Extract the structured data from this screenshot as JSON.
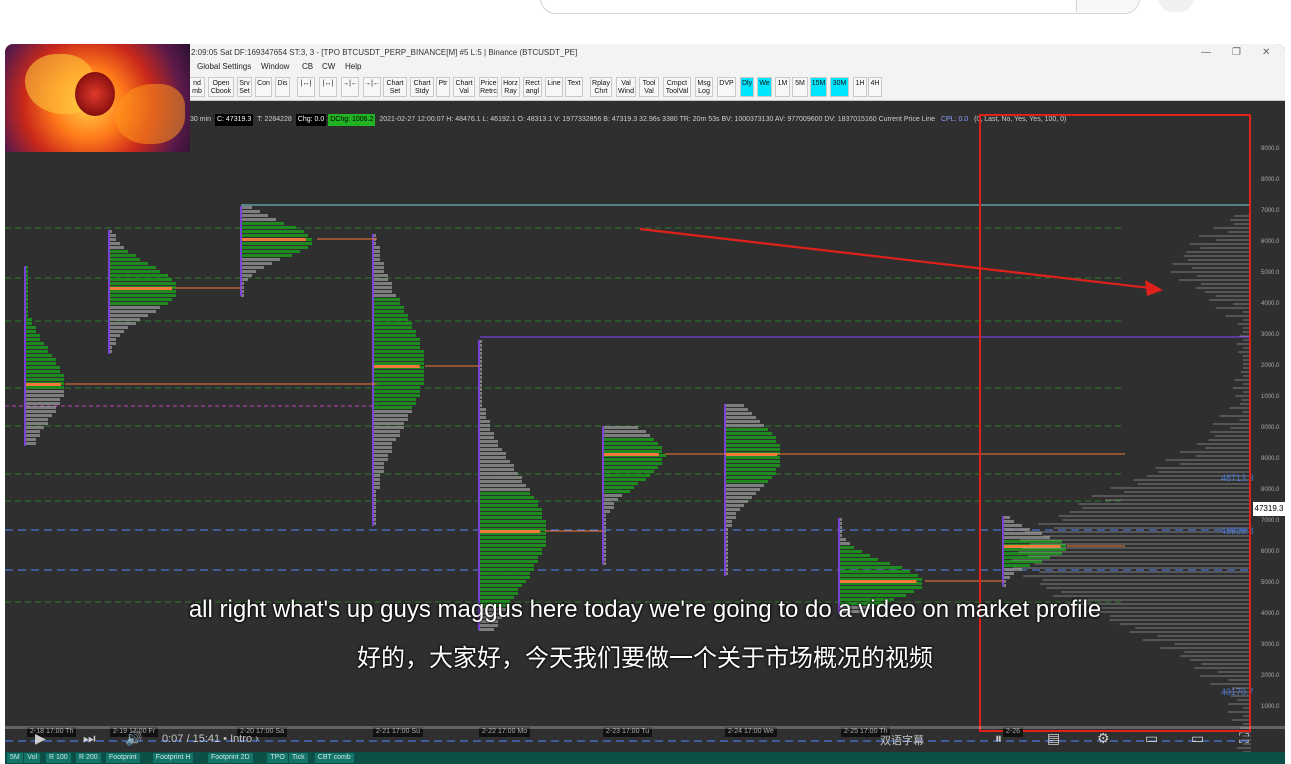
{
  "window": {
    "title": "2:09:05 Sat  DF:169347654  ST:3, 3 - [TPO BTCUSDT_PERP_BINANCE[M]  #5 L:5 | Binance (BTCUSDT_PE]"
  },
  "menu": [
    "Global Settings",
    "Window",
    "CB",
    "CW",
    "Help"
  ],
  "toolbar": {
    "buttons": [
      {
        "label": "nd\nmb"
      },
      {
        "label": "Open\nCbook"
      },
      {
        "label": "Srv\nSet"
      },
      {
        "label": "Con"
      },
      {
        "label": "Dis"
      },
      {
        "label": "|↔|"
      },
      {
        "label": "|↔|"
      },
      {
        "label": "→|←"
      },
      {
        "label": "→|←"
      },
      {
        "label": "Chart\nSet"
      },
      {
        "label": "Chart\nStdy"
      },
      {
        "label": "Ptr"
      },
      {
        "label": "Chart\nVal"
      },
      {
        "label": "Price\nRetrc"
      },
      {
        "label": "Horz\nRay"
      },
      {
        "label": "Rect\nangl"
      },
      {
        "label": "Line"
      },
      {
        "label": "Text"
      },
      {
        "label": "Rplay\nChrt"
      },
      {
        "label": "Val\nWind"
      },
      {
        "label": "Tool\nVal"
      },
      {
        "label": "Cmpct\nToolVal"
      },
      {
        "label": "Msg\nLog"
      },
      {
        "label": "DVP"
      },
      {
        "label": "Dly"
      },
      {
        "label": "We"
      },
      {
        "label": "1M"
      },
      {
        "label": "5M"
      },
      {
        "label": "15M"
      },
      {
        "label": "30M"
      },
      {
        "label": "1H"
      },
      {
        "label": "4H"
      }
    ]
  },
  "infobar": {
    "prefix": "30 min",
    "c_value": "C: 47319.3",
    "t_value": "T: 2284228",
    "chg": "Chg: 0.0",
    "dchg": "DChg: 1006.2",
    "details": "2021-02-27 12:00:07  H: 48476.1  L: 46192.1  O: 48313.1  V: 1977332856  B: 47319.3  32.96s 3380  TR: 20m 53s  BV: 1000373130  AV: 977009600  DV: 1837015160  Current Price Line",
    "cpl": "CPL: 0.0",
    "cpl_rest": "(0, Last, No, Yes, Yes, 100, 0)"
  },
  "price_tag": "47319.3",
  "level_labels": [
    {
      "text": "48713.9"
    },
    {
      "text": "46988.8"
    },
    {
      "text": "43170.7"
    }
  ],
  "price_axis": [
    "9000.0",
    "8000.0",
    "7000.0",
    "6000.0",
    "5000.0",
    "4000.0",
    "3000.0",
    "2000.0",
    "1000.0",
    "0000.0",
    "9000.0",
    "8000.0",
    "7000.0",
    "6000.0",
    "5000.0",
    "4000.0",
    "3000.0",
    "2000.0",
    "1000.0"
  ],
  "dates": [
    "2-18 17:00 Th",
    "2-19 17:00 Fr",
    "2-20 17:00 Sa",
    "2-21 17:00 Su",
    "2-22 17:00 Mo",
    "2-23 17:00 Tu",
    "2-24 17:00 We",
    "2-25 17:00 Th",
    "2-26"
  ],
  "subtitles": {
    "english": "all right what's up guys maggus here today we're going to do a video on market profile",
    "chinese": "好的，大家好，今天我们要做一个关于市场概况的视频"
  },
  "player": {
    "time": "0:07 / 15:41",
    "chapter": "• Intro ›",
    "subtitle_button": "双语字幕"
  },
  "chart_tabs": [
    "5M",
    "Vol",
    "R 100",
    "R 200",
    "Footprint",
    "Footprint H",
    "Footprint 2D",
    "TPO",
    "Tick",
    "CBT comb"
  ],
  "colors": {
    "accent_red": "#e0201a",
    "tpo_green": "#1f8f1f",
    "poc_orange": "#f07a3a",
    "value_area_line": "#4a76d8",
    "cyan_line": "#7fd7e0",
    "purple_line": "#7b42d6"
  }
}
